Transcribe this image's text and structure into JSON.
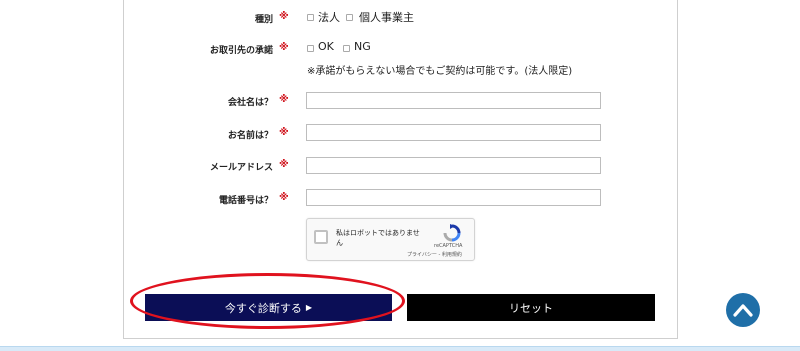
{
  "form": {
    "required_mark": "※",
    "type_field": {
      "label": "種別",
      "options": [
        "法人",
        "個人事業主"
      ]
    },
    "consent_field": {
      "label": "お取引先の承諾",
      "options": [
        "OK",
        "NG"
      ],
      "note": "※承諾がもらえない場合でもご契約は可能です。(法人限定)"
    },
    "company_field": {
      "label": "会社名は？",
      "value": ""
    },
    "name_field": {
      "label": "お名前は？",
      "value": ""
    },
    "email_field": {
      "label": "メールアドレス",
      "value": ""
    },
    "phone_field": {
      "label": "電話番号は？",
      "value": ""
    }
  },
  "captcha": {
    "label": "私はロボットではありません",
    "brand": "reCAPTCHA",
    "links": "プライバシー - 利用規約"
  },
  "buttons": {
    "submit_label": "今すぐ診断する",
    "submit_arrow": "▶",
    "reset_label": "リセット"
  },
  "colors": {
    "required": "#d0161f",
    "submit_bg": "#0b0e56",
    "reset_bg": "#000000",
    "highlight": "#e0121e",
    "scroll_top_bg": "#1f6fa8"
  },
  "icons": {
    "scroll_top": "chevron-up-icon",
    "captcha_logo": "recaptcha-icon"
  }
}
